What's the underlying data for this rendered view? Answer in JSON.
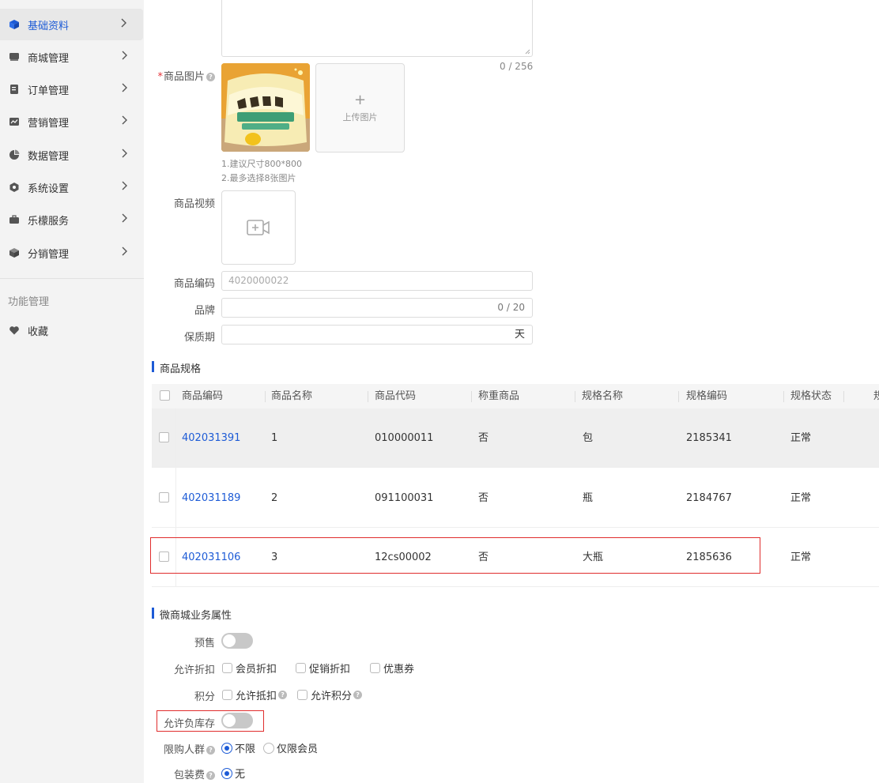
{
  "sidebar": {
    "items": [
      {
        "label": "基础资料",
        "icon": "cube-icon",
        "active": true
      },
      {
        "label": "商城管理",
        "icon": "store-icon"
      },
      {
        "label": "订单管理",
        "icon": "order-icon"
      },
      {
        "label": "营销管理",
        "icon": "marketing-chart-icon"
      },
      {
        "label": "数据管理",
        "icon": "pie-chart-icon"
      },
      {
        "label": "系统设置",
        "icon": "settings-hexagon-icon"
      },
      {
        "label": "乐檬服务",
        "icon": "briefcase-icon"
      },
      {
        "label": "分销管理",
        "icon": "box-icon"
      }
    ],
    "section_label": "功能管理",
    "favorites_label": "收藏"
  },
  "form": {
    "desc_counter": "0 / 256",
    "image_label": "商品图片",
    "required_mark": "*",
    "upload_plus": "+",
    "upload_label": "上传图片",
    "image_tip_1": "1.建议尺寸800*800",
    "image_tip_2": "2.最多选择8张图片",
    "video_label": "商品视频",
    "code_label": "商品编码",
    "code_placeholder": "4020000022",
    "brand_label": "品牌",
    "brand_counter": "0 / 20",
    "shelf_life_label": "保质期",
    "shelf_life_suffix": "天"
  },
  "spec_section": {
    "title": "商品规格",
    "columns": [
      "商品编码",
      "商品名称",
      "商品代码",
      "称重商品",
      "规格名称",
      "规格编码",
      "规格状态",
      "规"
    ],
    "rows": [
      {
        "code": "402031391",
        "name": "1",
        "item_code": "010000011",
        "weighted": "否",
        "spec_name": "包",
        "spec_code": "2185341",
        "status": "正常"
      },
      {
        "code": "402031189",
        "name": "2",
        "item_code": "091100031",
        "weighted": "否",
        "spec_name": "瓶",
        "spec_code": "2184767",
        "status": "正常"
      },
      {
        "code": "402031106",
        "name": "3",
        "item_code": "12cs00002",
        "weighted": "否",
        "spec_name": "大瓶",
        "spec_code": "2185636",
        "status": "正常"
      }
    ]
  },
  "mall_section": {
    "title": "微商城业务属性",
    "presale_label": "预售",
    "discount_label": "允许折扣",
    "discount_options": [
      "会员折扣",
      "促销折扣",
      "优惠券"
    ],
    "points_label": "积分",
    "points_options": [
      "允许抵扣",
      "允许积分"
    ],
    "negative_stock_label": "允许负库存",
    "limit_group_label": "限购人群",
    "limit_group_options": [
      "不限",
      "仅限会员"
    ],
    "packing_fee_label": "包装费",
    "packing_fee_options": [
      "无"
    ]
  },
  "colors": {
    "accent": "#1d5bd6",
    "highlight_border": "#e02d2d"
  }
}
